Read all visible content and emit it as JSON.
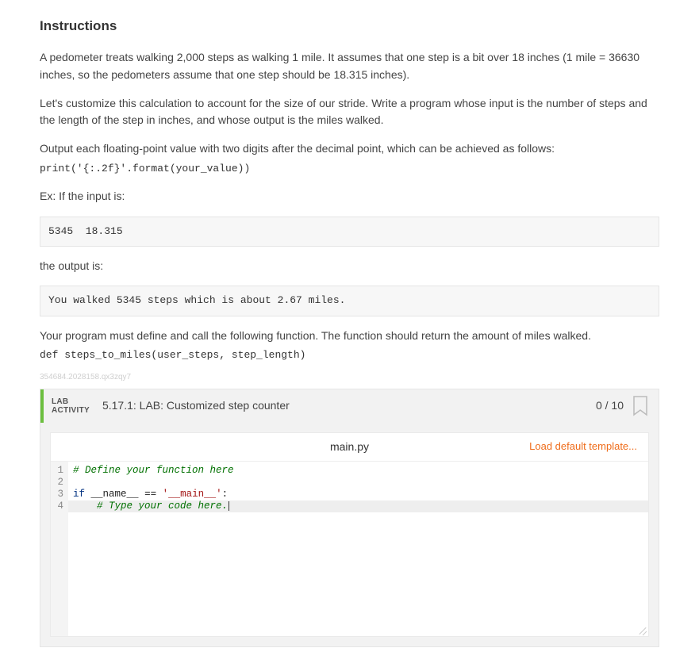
{
  "heading": "Instructions",
  "para1": "A pedometer treats walking 2,000 steps as walking 1 mile. It assumes that one step is a bit over 18 inches (1 mile = 36630 inches, so the pedometers assume that one step should be 18.315 inches).",
  "para2": "Let's customize this calculation to account for the size of our stride. Write a program whose input is the number of steps and the length of the step in inches, and whose output is the miles walked.",
  "para3": "Output each floating-point value with two digits after the decimal point, which can be achieved as follows:",
  "print_line": "print('{:.2f}'.format(your_value))",
  "ex_intro": "Ex: If the input is:",
  "input_block": "5345  18.315",
  "output_intro": "the output is:",
  "output_block": "You walked 5345 steps which is about 2.67 miles.",
  "def_intro": "Your program must define and call the following function. The function should return the amount of miles walked.",
  "def_sig": "def steps_to_miles(user_steps, step_length)",
  "watermark": "354684.2028158.qx3zqy7",
  "lab": {
    "tag_line1": "LAB",
    "tag_line2": "ACTIVITY",
    "title": "5.17.1: LAB: Customized step counter",
    "score": "0 / 10"
  },
  "editor": {
    "filename": "main.py",
    "load_template": "Load default template...",
    "lines": {
      "l1_comment": "# Define your function here",
      "l3_kw": "if",
      "l3_name": "__name__",
      "l3_eq": "==",
      "l3_str": "'__main__'",
      "l3_colon": ":",
      "l4_comment": "# Type your code here."
    },
    "line_numbers": [
      "1",
      "2",
      "3",
      "4"
    ]
  }
}
